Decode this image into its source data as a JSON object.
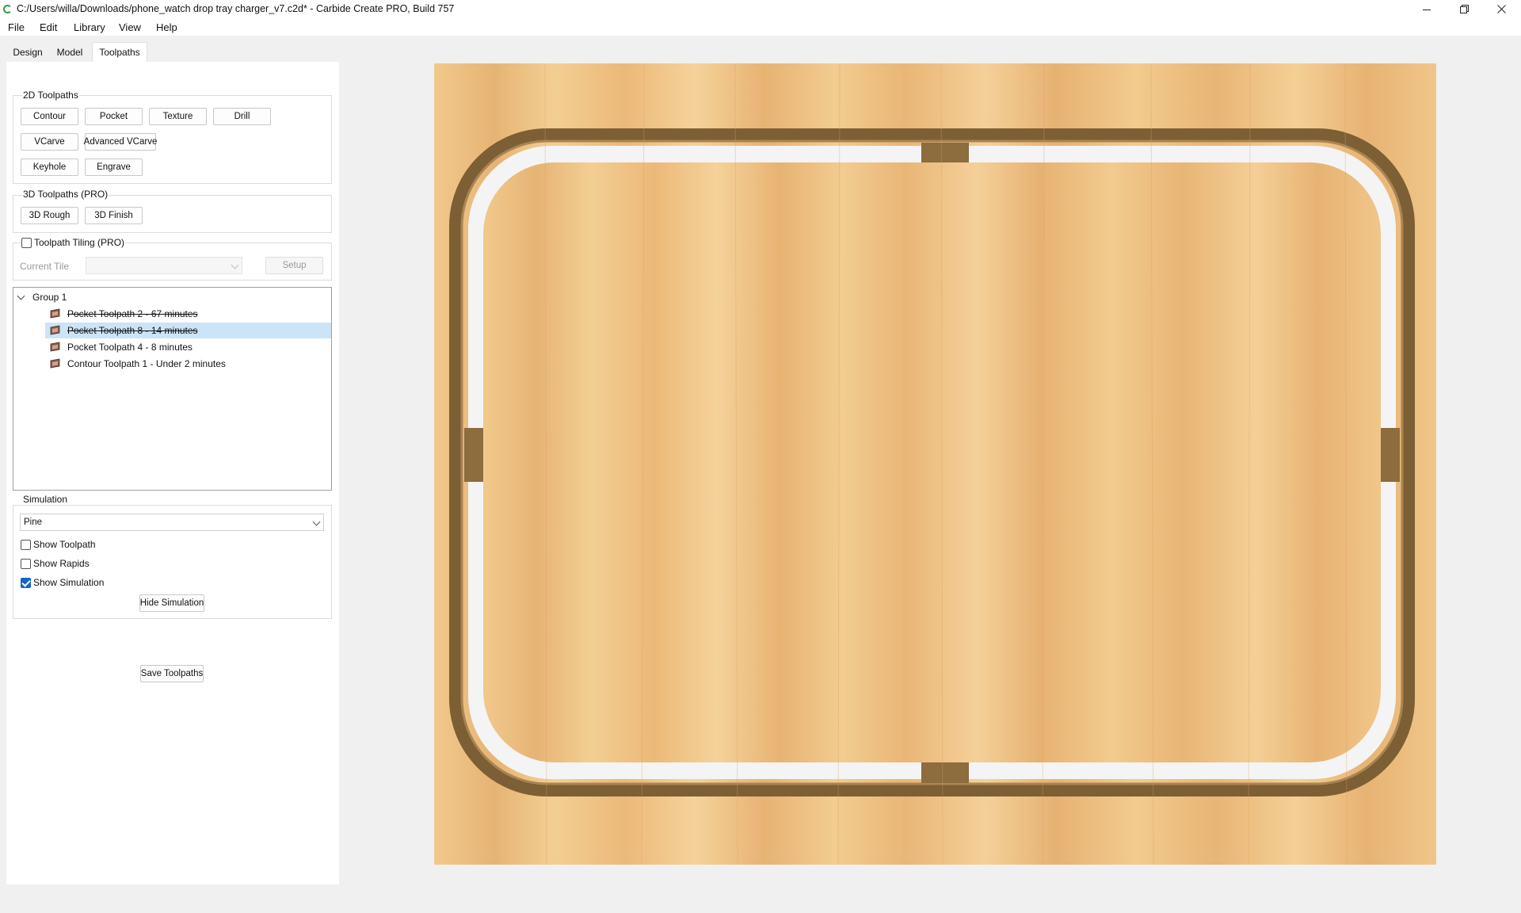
{
  "window": {
    "title": "C:/Users/willa/Downloads/phone_watch drop tray charger_v7.c2d* - Carbide Create PRO, Build 757",
    "minimize_icon": "minimize-icon",
    "maximize_icon": "restore-icon",
    "close_icon": "close-icon"
  },
  "menu": [
    "File",
    "Edit",
    "Library",
    "View",
    "Help"
  ],
  "tabs": [
    {
      "label": "Design",
      "active": false
    },
    {
      "label": "Model",
      "active": false
    },
    {
      "label": "Toolpaths",
      "active": true
    }
  ],
  "toolpaths_2d": {
    "title": "2D Toolpaths",
    "buttons": [
      "Contour",
      "Pocket",
      "Texture",
      "Drill",
      "VCarve",
      "Advanced VCarve",
      "Keyhole",
      "Engrave"
    ]
  },
  "toolpaths_3d": {
    "title": "3D Toolpaths (PRO)",
    "buttons": [
      "3D Rough",
      "3D Finish"
    ]
  },
  "tiling": {
    "label": "Toolpath Tiling (PRO)",
    "checked": false,
    "current_tile_label": "Current Tile",
    "current_tile_value": "",
    "setup_label": "Setup"
  },
  "tree": {
    "group_label": "Group 1",
    "items": [
      {
        "label": "Pocket Toolpath 2 - 67 minutes",
        "disabled": true,
        "selected": false
      },
      {
        "label": "Pocket Toolpath 8 - 14 minutes",
        "disabled": true,
        "selected": true
      },
      {
        "label": "Pocket Toolpath 4 - 8 minutes",
        "disabled": false,
        "selected": false
      },
      {
        "label": "Contour Toolpath 1 - Under 2 minutes",
        "disabled": false,
        "selected": false
      }
    ]
  },
  "simulation": {
    "title": "Simulation",
    "material": "Pine",
    "show_toolpath": {
      "label": "Show Toolpath",
      "checked": false
    },
    "show_rapids": {
      "label": "Show Rapids",
      "checked": false
    },
    "show_simulation": {
      "label": "Show Simulation",
      "checked": true
    },
    "hide_button": "Hide Simulation"
  },
  "save_button": "Save Toolpaths",
  "colors": {
    "accent": "#1565c0",
    "selection": "#cce4f7",
    "wood": "#efc07e",
    "groove": "#8a6b3f"
  }
}
